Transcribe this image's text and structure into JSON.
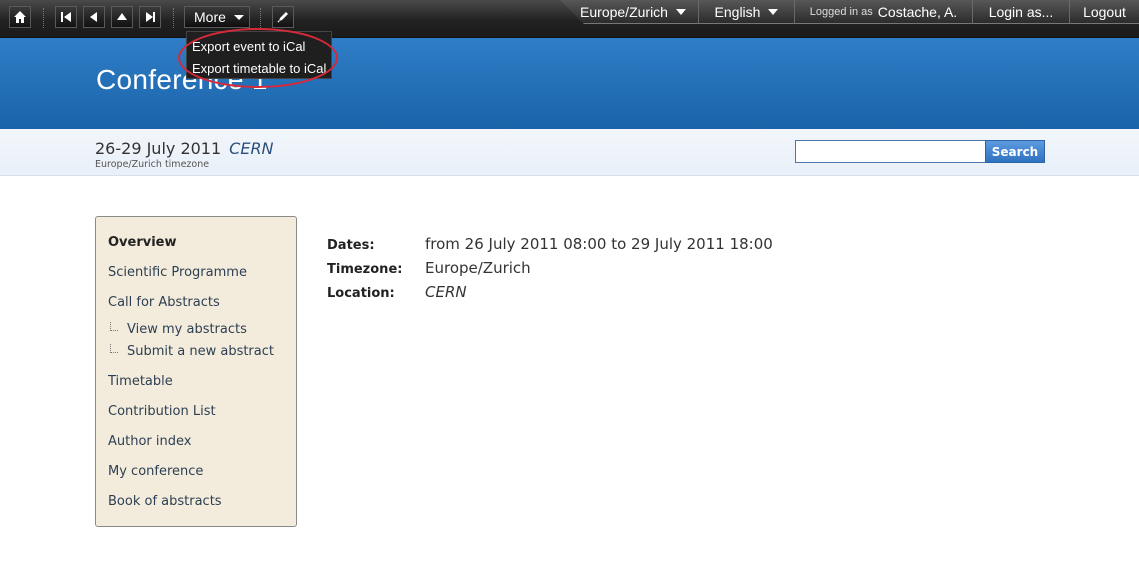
{
  "toolbar": {
    "more_label": "More",
    "icons": [
      "home-icon",
      "first-icon",
      "previous-icon",
      "up-icon",
      "next-icon",
      "edit-icon"
    ],
    "more_menu": [
      {
        "label": "Export event to iCal"
      },
      {
        "label": "Export timetable to iCal"
      }
    ]
  },
  "session": {
    "timezone": "Europe/Zurich",
    "language": "English",
    "logged_in_prefix": "Logged in as",
    "user": "Costache, A.",
    "login_as": "Login as...",
    "logout": "Logout"
  },
  "header": {
    "title": "Conference 1"
  },
  "subheader": {
    "dates": "26-29 July 2011",
    "location": "CERN",
    "timezone_note": "Europe/Zurich timezone",
    "search_placeholder": "",
    "search_label": "Search"
  },
  "sidebar": {
    "items": [
      {
        "label": "Overview"
      },
      {
        "label": "Scientific Programme"
      },
      {
        "label": "Call for Abstracts"
      },
      {
        "label": "View my abstracts"
      },
      {
        "label": "Submit a new abstract"
      },
      {
        "label": "Timetable"
      },
      {
        "label": "Contribution List"
      },
      {
        "label": "Author index"
      },
      {
        "label": "My conference"
      },
      {
        "label": "Book of abstracts"
      }
    ]
  },
  "details": {
    "rows": [
      {
        "label": "Dates:",
        "value": "from 26 July 2011 08:00 to 29 July 2011 18:00"
      },
      {
        "label": "Timezone:",
        "value": "Europe/Zurich"
      },
      {
        "label": "Location:",
        "value": "CERN"
      }
    ]
  },
  "colors": {
    "banner": "#1f6fb8",
    "toolbar": "#222222",
    "sidebar_bg": "#f3ecdc",
    "highlight": "#d62a3a"
  }
}
